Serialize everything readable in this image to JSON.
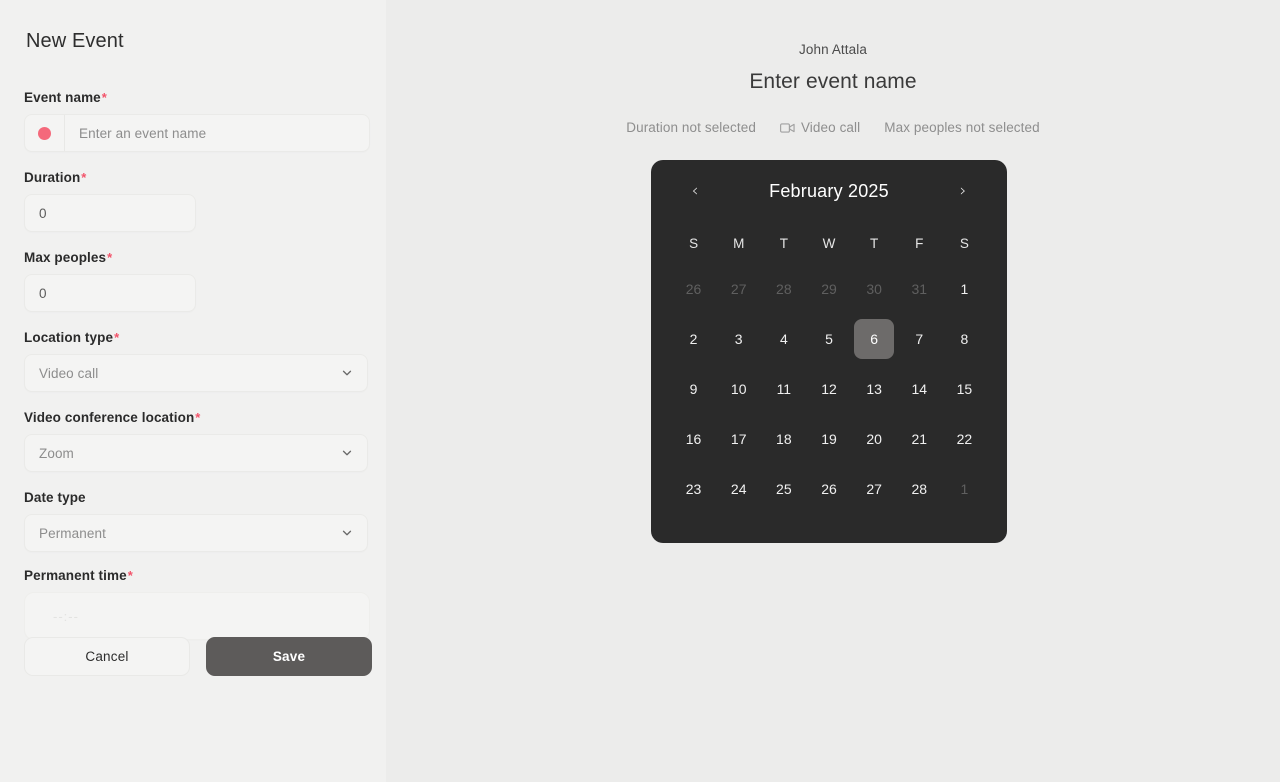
{
  "form": {
    "title": "New Event",
    "fields": [
      {
        "key": "event_name",
        "label": "Event name",
        "required": true,
        "type": "text-with-color",
        "placeholder": "Enter an event name",
        "value": "",
        "color": "#f4697b"
      },
      {
        "key": "duration",
        "label": "Duration",
        "required": true,
        "type": "number",
        "value": "0",
        "placeholder": "0"
      },
      {
        "key": "max_peoples",
        "label": "Max peoples",
        "required": true,
        "type": "number",
        "value": "0",
        "placeholder": "0"
      },
      {
        "key": "location_type",
        "label": "Location type",
        "required": true,
        "type": "select",
        "value": "Video call"
      },
      {
        "key": "video_conference_location",
        "label": "Video conference location",
        "required": true,
        "type": "select",
        "value": "Zoom"
      },
      {
        "key": "date_type",
        "label": "Date type",
        "required": false,
        "type": "select",
        "value": "Permanent"
      },
      {
        "key": "permanent_time",
        "label": "Permanent time",
        "required": true,
        "type": "time",
        "value": "",
        "placeholder": "--:--"
      }
    ],
    "buttons": {
      "cancel_label": "Cancel",
      "save_label": "Save"
    }
  },
  "preview": {
    "host_name": "John Attala",
    "event_title": "Enter event name",
    "meta": {
      "duration": "Duration not selected",
      "location": "Video call",
      "location_icon": "video-camera-icon",
      "max_peoples": "Max peoples not selected"
    }
  },
  "calendar": {
    "month_label": "February 2025",
    "prev_label": "‹",
    "next_label": "›",
    "weekdays": [
      "S",
      "M",
      "T",
      "W",
      "T",
      "F",
      "S"
    ],
    "selected_day": 6,
    "days": [
      {
        "n": "26",
        "muted": true
      },
      {
        "n": "27",
        "muted": true
      },
      {
        "n": "28",
        "muted": true
      },
      {
        "n": "29",
        "muted": true
      },
      {
        "n": "30",
        "muted": true
      },
      {
        "n": "31",
        "muted": true
      },
      {
        "n": "1",
        "muted": false
      },
      {
        "n": "2",
        "muted": false
      },
      {
        "n": "3",
        "muted": false
      },
      {
        "n": "4",
        "muted": false
      },
      {
        "n": "5",
        "muted": false
      },
      {
        "n": "6",
        "muted": false,
        "selected": true
      },
      {
        "n": "7",
        "muted": false
      },
      {
        "n": "8",
        "muted": false
      },
      {
        "n": "9",
        "muted": false
      },
      {
        "n": "10",
        "muted": false
      },
      {
        "n": "11",
        "muted": false
      },
      {
        "n": "12",
        "muted": false
      },
      {
        "n": "13",
        "muted": false
      },
      {
        "n": "14",
        "muted": false
      },
      {
        "n": "15",
        "muted": false
      },
      {
        "n": "16",
        "muted": false
      },
      {
        "n": "17",
        "muted": false
      },
      {
        "n": "18",
        "muted": false
      },
      {
        "n": "19",
        "muted": false
      },
      {
        "n": "20",
        "muted": false
      },
      {
        "n": "21",
        "muted": false
      },
      {
        "n": "22",
        "muted": false
      },
      {
        "n": "23",
        "muted": false
      },
      {
        "n": "24",
        "muted": false
      },
      {
        "n": "25",
        "muted": false
      },
      {
        "n": "26",
        "muted": false
      },
      {
        "n": "27",
        "muted": false
      },
      {
        "n": "28",
        "muted": false
      },
      {
        "n": "1",
        "muted": true
      }
    ]
  },
  "colors": {
    "page_bg": "#ececeb",
    "panel_bg": "#f1f1f0",
    "calendar_bg": "#2a2a2a",
    "accent_required": "#f2536a",
    "save_button": "#5d5b5a",
    "event_dot": "#f4697b"
  }
}
